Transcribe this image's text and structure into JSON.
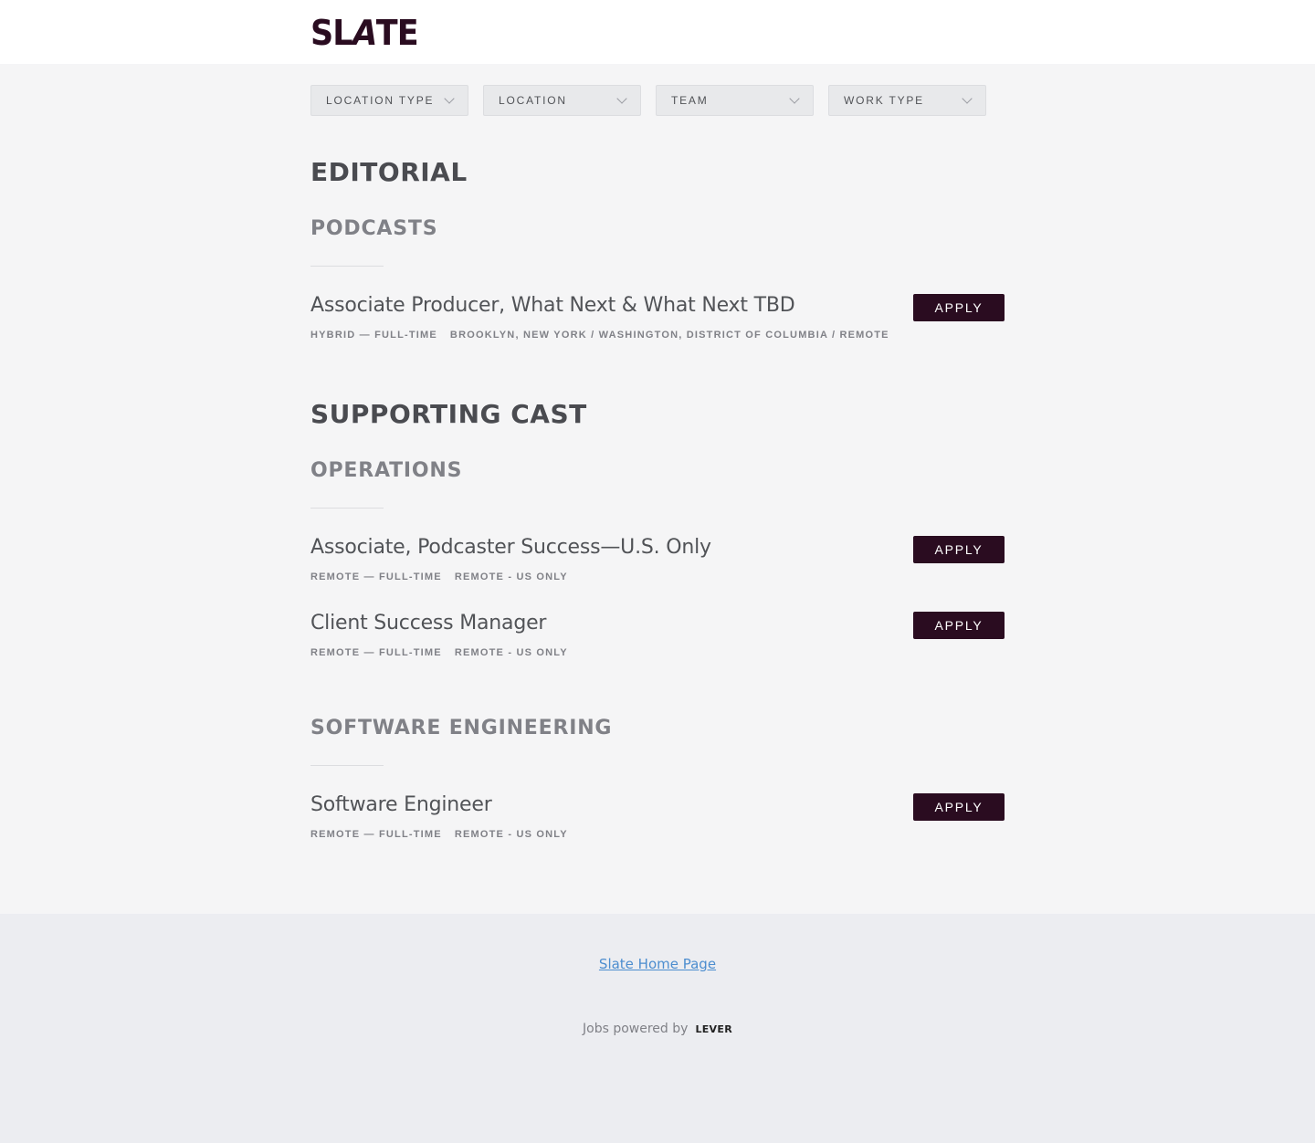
{
  "header": {
    "logo_text": "SL/ATE"
  },
  "filters": [
    {
      "label": "LOCATION TYPE"
    },
    {
      "label": "LOCATION"
    },
    {
      "label": "TEAM"
    },
    {
      "label": "WORK TYPE"
    }
  ],
  "departments": [
    {
      "name": "EDITORIAL",
      "teams": [
        {
          "name": "PODCASTS",
          "postings": [
            {
              "title": "Associate Producer, What Next & What Next TBD",
              "commitment": "HYBRID — FULL-TIME",
              "location": "BROOKLYN, NEW YORK / WASHINGTON, DISTRICT OF COLUMBIA / REMOTE",
              "apply_label": "APPLY"
            }
          ]
        }
      ]
    },
    {
      "name": "SUPPORTING CAST",
      "teams": [
        {
          "name": "OPERATIONS",
          "postings": [
            {
              "title": "Associate, Podcaster Success—U.S. Only",
              "commitment": "REMOTE — FULL-TIME",
              "location": "REMOTE - US ONLY",
              "apply_label": "APPLY"
            },
            {
              "title": "Client Success Manager",
              "commitment": "REMOTE — FULL-TIME",
              "location": "REMOTE - US ONLY",
              "apply_label": "APPLY"
            }
          ]
        },
        {
          "name": "SOFTWARE ENGINEERING",
          "postings": [
            {
              "title": "Software Engineer",
              "commitment": "REMOTE — FULL-TIME",
              "location": "REMOTE - US ONLY",
              "apply_label": "APPLY"
            }
          ]
        }
      ]
    }
  ],
  "footer": {
    "home_link": "Slate Home Page",
    "powered_by": "Jobs powered by",
    "powered_brand": "LEVER"
  }
}
